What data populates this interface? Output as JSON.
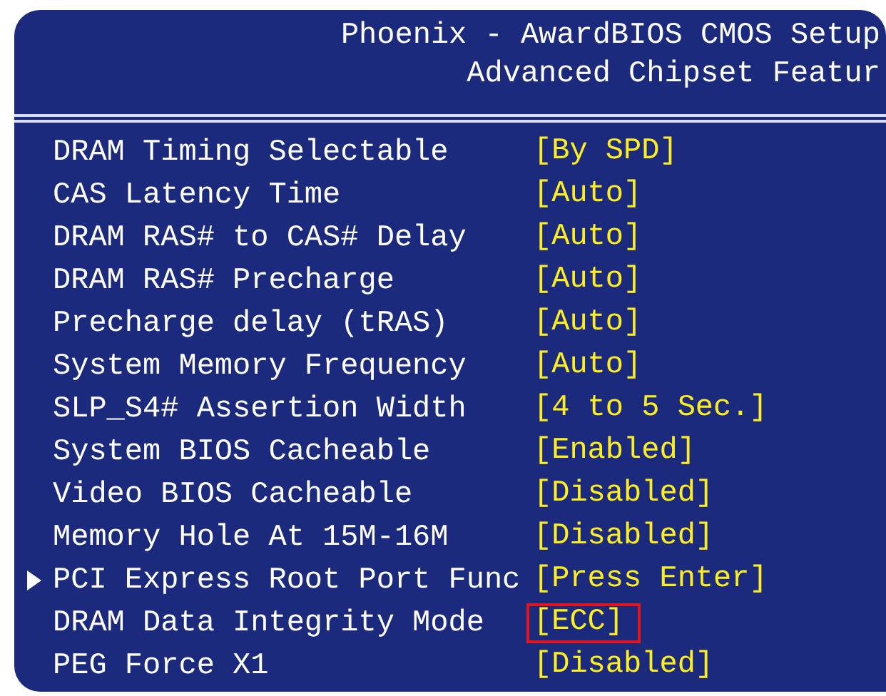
{
  "header": {
    "title": "Phoenix - AwardBIOS CMOS Setup",
    "subtitle": "Advanced Chipset Featur"
  },
  "settings": [
    {
      "label": "DRAM Timing Selectable",
      "value": "[By SPD]",
      "submenu": false,
      "highlighted": false
    },
    {
      "label": "CAS Latency Time",
      "value": "[Auto]",
      "submenu": false,
      "highlighted": false
    },
    {
      "label": "DRAM RAS# to CAS# Delay",
      "value": "[Auto]",
      "submenu": false,
      "highlighted": false
    },
    {
      "label": "DRAM RAS# Precharge",
      "value": "[Auto]",
      "submenu": false,
      "highlighted": false
    },
    {
      "label": "Precharge delay (tRAS)",
      "value": "[Auto]",
      "submenu": false,
      "highlighted": false
    },
    {
      "label": "System Memory Frequency",
      "value": "[Auto]",
      "submenu": false,
      "highlighted": false
    },
    {
      "label": "SLP_S4# Assertion Width",
      "value": "[4 to 5 Sec.]",
      "submenu": false,
      "highlighted": false
    },
    {
      "label": "System BIOS Cacheable",
      "value": "[Enabled]",
      "submenu": false,
      "highlighted": false
    },
    {
      "label": "Video BIOS Cacheable",
      "value": "[Disabled]",
      "submenu": false,
      "highlighted": false
    },
    {
      "label": "Memory Hole At 15M-16M",
      "value": "[Disabled]",
      "submenu": false,
      "highlighted": false
    },
    {
      "label": "PCI Express Root Port Func",
      "value": "[Press Enter]",
      "submenu": true,
      "highlighted": false
    },
    {
      "label": "DRAM Data Integrity Mode",
      "value": "[ECC]",
      "submenu": false,
      "highlighted": true
    },
    {
      "label": "PEG Force X1",
      "value": "[Disabled]",
      "submenu": false,
      "highlighted": false
    }
  ]
}
